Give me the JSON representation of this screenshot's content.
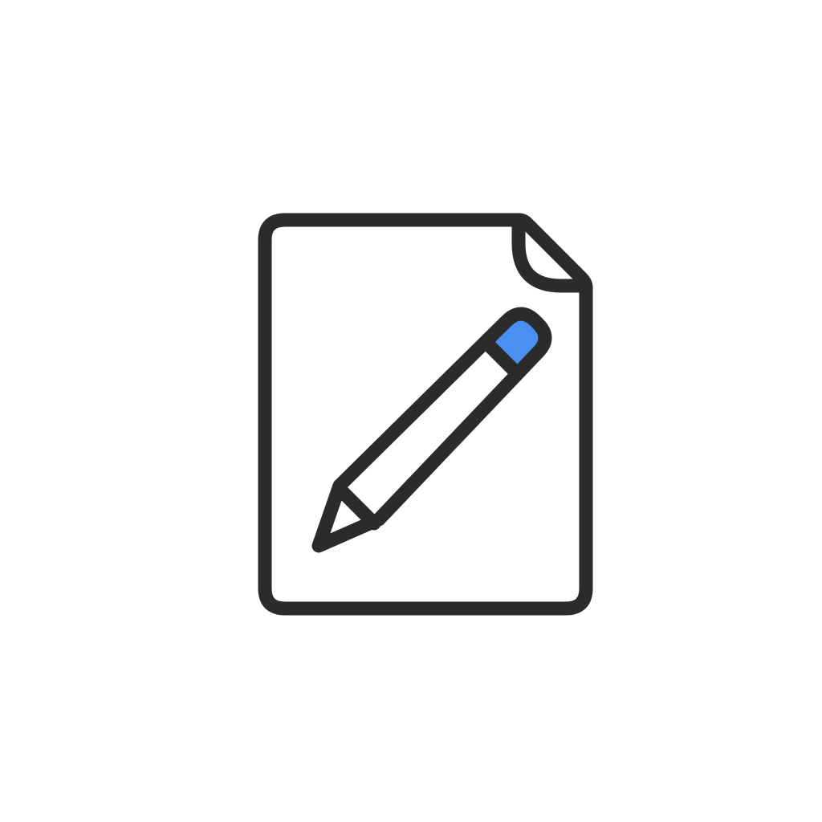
{
  "icon": {
    "name": "edit-document-icon",
    "parts": [
      "document-icon",
      "pencil-icon"
    ]
  },
  "colors": {
    "background": "#ffffff",
    "outline": "#2b2b2b",
    "fill": "#ffffff",
    "accent": "#4a90f0"
  }
}
